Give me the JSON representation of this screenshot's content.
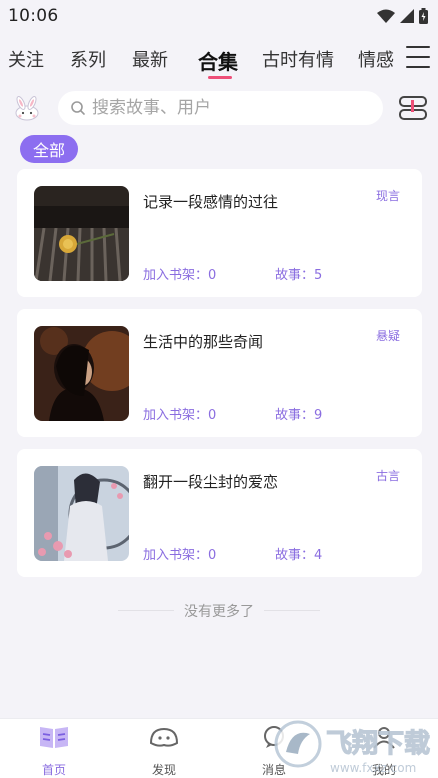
{
  "status_bar": {
    "time": "10:06"
  },
  "tabs": [
    {
      "label": "关注"
    },
    {
      "label": "系列"
    },
    {
      "label": "最新"
    },
    {
      "label": "合集",
      "active": true
    },
    {
      "label": "古时有情"
    },
    {
      "label": "情感"
    }
  ],
  "search": {
    "placeholder": "搜索故事、用户"
  },
  "filter": {
    "label": "全部"
  },
  "collections": [
    {
      "title": "记录一段感情的过往",
      "tag": "现言",
      "shelf_label": "加入书架：0",
      "stories_label": "故事：5"
    },
    {
      "title": "生活中的那些奇闻",
      "tag": "悬疑",
      "shelf_label": "加入书架：0",
      "stories_label": "故事：9"
    },
    {
      "title": "翻开一段尘封的爱恋",
      "tag": "古言",
      "shelf_label": "加入书架：0",
      "stories_label": "故事：4"
    }
  ],
  "end_text": "没有更多了",
  "bottom_nav": [
    {
      "label": "首页",
      "icon": "book-icon",
      "active": true
    },
    {
      "label": "发现",
      "icon": "discover-icon"
    },
    {
      "label": "消息",
      "icon": "message-icon"
    },
    {
      "label": "我的",
      "icon": "profile-icon"
    }
  ],
  "watermark": {
    "brand": "飞翔下载",
    "site": "www.fxxz.com"
  },
  "colors": {
    "accent": "#8a6de0",
    "tab_indicator": "#ee4f78",
    "background": "#f4f3f8"
  }
}
